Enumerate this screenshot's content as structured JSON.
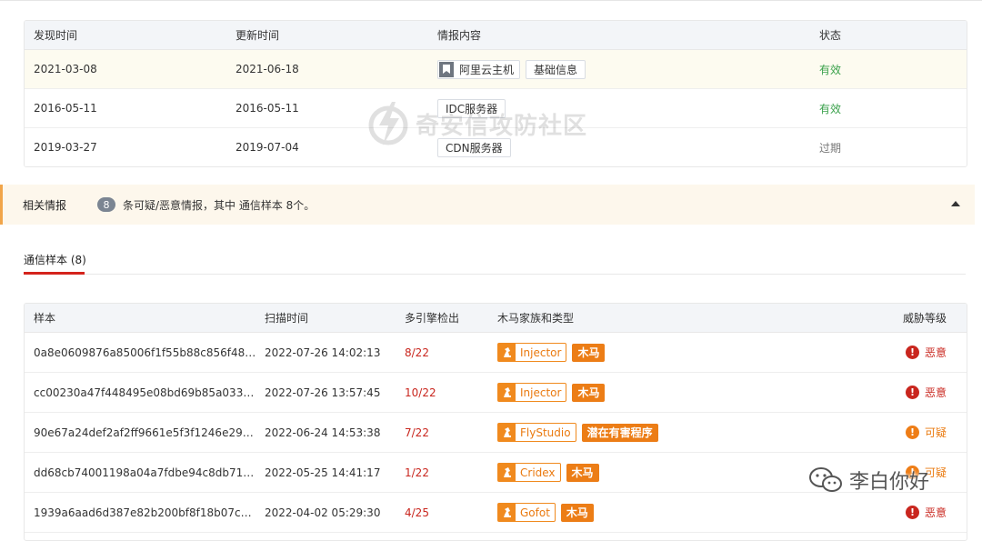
{
  "intel_table": {
    "headers": [
      "发现时间",
      "更新时间",
      "情报内容",
      "状态"
    ],
    "rows": [
      {
        "found": "2021-03-08",
        "updated": "2021-06-18",
        "tags": [
          "阿里云主机",
          "基础信息"
        ],
        "status": "有效",
        "status_type": "valid"
      },
      {
        "found": "2016-05-11",
        "updated": "2016-05-11",
        "tags": [
          "IDC服务器"
        ],
        "status": "有效",
        "status_type": "valid"
      },
      {
        "found": "2019-03-27",
        "updated": "2019-07-04",
        "tags": [
          "CDN服务器"
        ],
        "status": "过期",
        "status_type": "expired"
      }
    ]
  },
  "watermark": {
    "text": "奇安信攻防社区"
  },
  "related": {
    "title": "相关情报",
    "count": "8",
    "description": "条可疑/恶意情报，其中 通信样本 8个。"
  },
  "tabs": {
    "active_label": "通信样本 (8)"
  },
  "samples_table": {
    "headers": [
      "样本",
      "扫描时间",
      "多引擎检出",
      "木马家族和类型",
      "威胁等级"
    ],
    "rows": [
      {
        "hash": "0a8e0609876a85006f1f55b88c856f48…",
        "scan_time": "2022-07-26 14:02:13",
        "detection": "8/22",
        "family": "Injector",
        "type": "木马",
        "threat": "恶意",
        "level": "malicious"
      },
      {
        "hash": "cc00230a47f448495e08bd69b85a033…",
        "scan_time": "2022-07-26 13:57:45",
        "detection": "10/22",
        "family": "Injector",
        "type": "木马",
        "threat": "恶意",
        "level": "malicious"
      },
      {
        "hash": "90e67a24def2af2ff9661e5f3f1246e29…",
        "scan_time": "2022-06-24 14:53:38",
        "detection": "7/22",
        "family": "FlyStudio",
        "type": "潜在有害程序",
        "threat": "可疑",
        "level": "suspicious"
      },
      {
        "hash": "dd68cb74001198a04a7fdbe94c8db71…",
        "scan_time": "2022-05-25 14:41:17",
        "detection": "1/22",
        "family": "Cridex",
        "type": "木马",
        "threat": "可疑",
        "level": "suspicious"
      },
      {
        "hash": "1939a6aad6d387e82b200bf8f18b07c…",
        "scan_time": "2022-04-02 05:29:30",
        "detection": "4/25",
        "family": "Gofot",
        "type": "木马",
        "threat": "恶意",
        "level": "malicious"
      }
    ]
  },
  "wechat_overlay": {
    "text": "李白你好"
  },
  "colors": {
    "accent_red": "#d4231c",
    "orange": "#ec7d16",
    "valid_green": "#3aa14b",
    "bar_bg": "#fdf7ec"
  },
  "icons": [
    "bookmark-icon",
    "horse-icon",
    "exclamation-icon",
    "collapse-arrow-icon",
    "wechat-icon"
  ]
}
